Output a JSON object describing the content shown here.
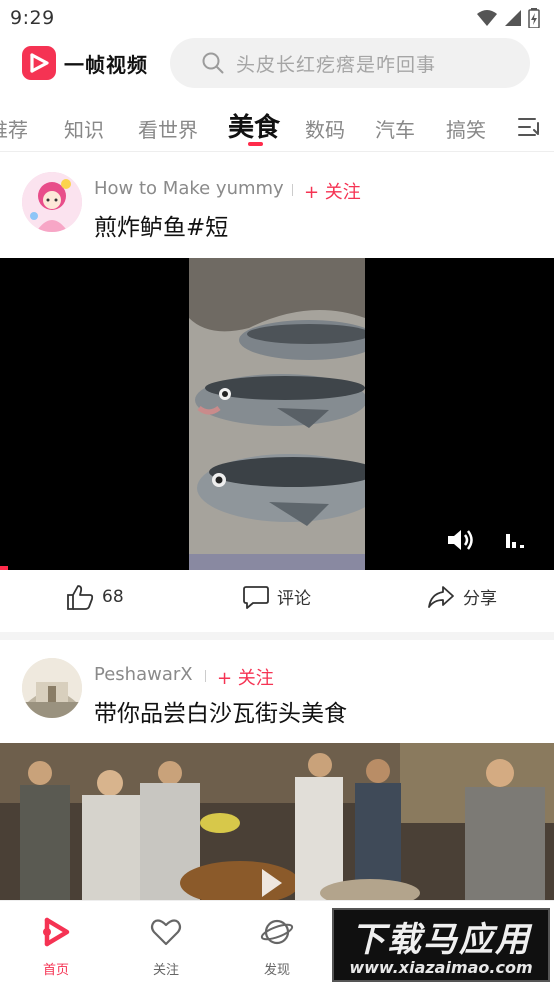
{
  "status_bar": {
    "time": "9:29"
  },
  "header": {
    "app_name": "一帧视频",
    "search_placeholder": "头皮长红疙瘩是咋回事"
  },
  "tabs": [
    {
      "label": "推荐"
    },
    {
      "label": "知识"
    },
    {
      "label": "看世界"
    },
    {
      "label": "美食",
      "active": true
    },
    {
      "label": "数码"
    },
    {
      "label": "汽车"
    },
    {
      "label": "搞笑"
    }
  ],
  "posts": [
    {
      "author": "How to Make yummy",
      "follow_label": "+ 关注",
      "title": "煎炸鲈鱼#短",
      "likes": "68",
      "comment_label": "评论",
      "share_label": "分享"
    },
    {
      "author": "PeshawarX",
      "follow_label": "+ 关注",
      "title": "带你品尝白沙瓦街头美食"
    }
  ],
  "bottom_nav": [
    {
      "label": "首页",
      "icon": "home-icon",
      "active": true
    },
    {
      "label": "关注",
      "icon": "heart-icon"
    },
    {
      "label": "发现",
      "icon": "planet-icon"
    }
  ],
  "watermark": {
    "title": "下载马应用",
    "url": "www.xiazaimao.com"
  },
  "colors": {
    "accent": "#f53353",
    "active_tab_indicator": "#ff2b4b",
    "search_bg": "#f1f1f1"
  }
}
